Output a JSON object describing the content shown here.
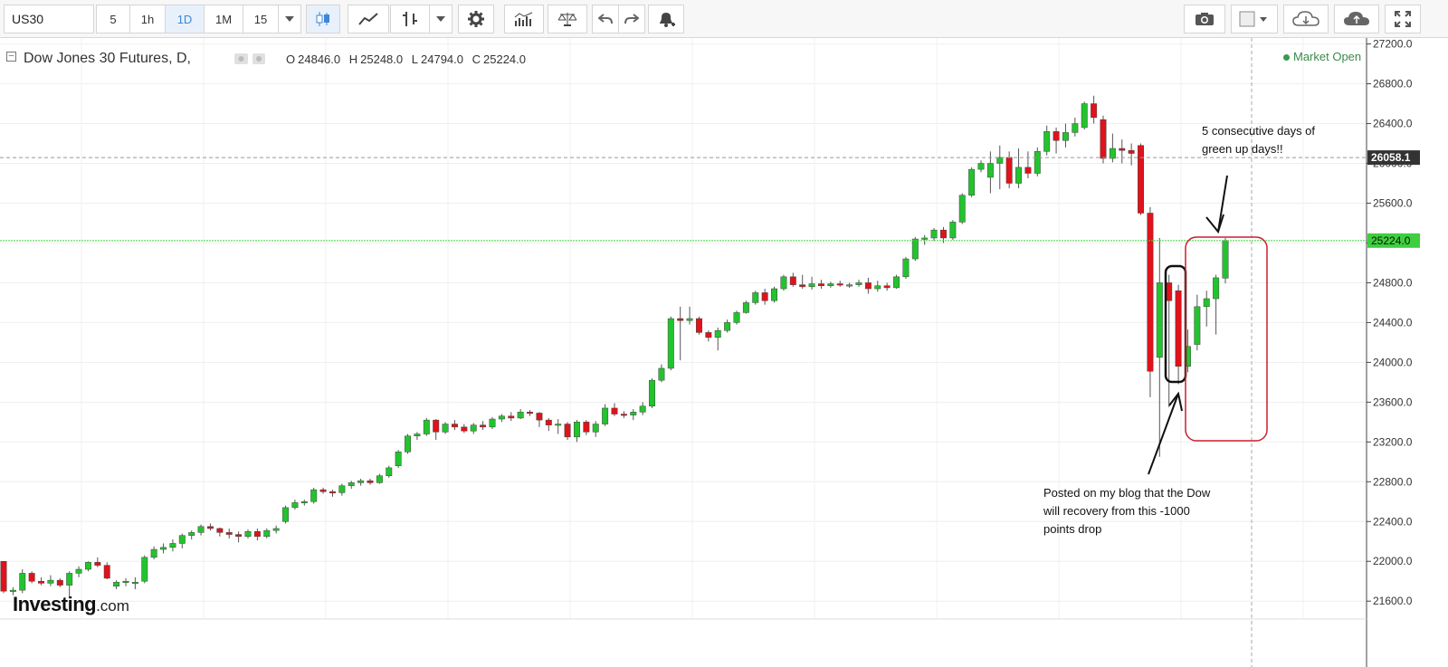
{
  "toolbar": {
    "symbol": "US30",
    "intervals": [
      {
        "label": "5",
        "active": false
      },
      {
        "label": "1h",
        "active": false
      },
      {
        "label": "1D",
        "active": true
      },
      {
        "label": "1M",
        "active": false
      },
      {
        "label": "15",
        "active": false
      }
    ],
    "icons": [
      "chevron-down-icon",
      "candlestick-icon",
      "line-chart-icon",
      "bar-chart-icon",
      "chevron-down-icon",
      "gear-icon",
      "indicators-icon",
      "balance-scale-icon",
      "undo-icon",
      "redo-icon",
      "alert-bell-icon",
      "camera-icon",
      "color-square-icon",
      "cloud-download-icon",
      "cloud-upload-icon",
      "fullscreen-icon"
    ]
  },
  "header": {
    "title": "Dow Jones 30 Futures, D,",
    "ohlc": {
      "O": "24846.0",
      "H": "25248.0",
      "L": "24794.0",
      "C": "25224.0"
    },
    "market_status": "Market Open",
    "logo_main": "Investing",
    "logo_suffix": ".com"
  },
  "annotations": {
    "top_note": "5 consecutive days of green up days!!",
    "bottom_note": "Posted on my blog that the Dow will recovery from this -1000 points drop"
  },
  "colors": {
    "up": "#22c42e",
    "down": "#e0121b",
    "price_line": "#3ecf3e",
    "red_box": "#cc1f2b"
  },
  "chart_data": {
    "type": "candlestick",
    "y_ticks": [
      21600,
      22000,
      22400,
      22800,
      23200,
      23600,
      24000,
      24400,
      24800,
      25200,
      25600,
      26000,
      26400,
      26800,
      27200
    ],
    "ylim": [
      21420,
      27260
    ],
    "current_price": "25224.0",
    "crosshair_price": "26058.1",
    "candles": [
      {
        "o": 22000,
        "h": 22000,
        "l": 21680,
        "c": 21700
      },
      {
        "o": 21700,
        "h": 21740,
        "l": 21660,
        "c": 21710
      },
      {
        "o": 21710,
        "h": 21920,
        "l": 21680,
        "c": 21880
      },
      {
        "o": 21880,
        "h": 21900,
        "l": 21780,
        "c": 21800
      },
      {
        "o": 21800,
        "h": 21840,
        "l": 21760,
        "c": 21780
      },
      {
        "o": 21780,
        "h": 21860,
        "l": 21750,
        "c": 21810
      },
      {
        "o": 21810,
        "h": 21830,
        "l": 21740,
        "c": 21760
      },
      {
        "o": 21760,
        "h": 21900,
        "l": 21640,
        "c": 21880
      },
      {
        "o": 21880,
        "h": 21950,
        "l": 21840,
        "c": 21920
      },
      {
        "o": 21920,
        "h": 22000,
        "l": 21900,
        "c": 21990
      },
      {
        "o": 21990,
        "h": 22040,
        "l": 21940,
        "c": 21960
      },
      {
        "o": 21960,
        "h": 21990,
        "l": 21820,
        "c": 21830
      },
      {
        "o": 21750,
        "h": 21810,
        "l": 21720,
        "c": 21790
      },
      {
        "o": 21790,
        "h": 21830,
        "l": 21750,
        "c": 21800
      },
      {
        "o": 21780,
        "h": 21840,
        "l": 21720,
        "c": 21790
      },
      {
        "o": 21800,
        "h": 22060,
        "l": 21780,
        "c": 22040
      },
      {
        "o": 22040,
        "h": 22150,
        "l": 22020,
        "c": 22120
      },
      {
        "o": 22120,
        "h": 22180,
        "l": 22080,
        "c": 22140
      },
      {
        "o": 22140,
        "h": 22220,
        "l": 22100,
        "c": 22180
      },
      {
        "o": 22180,
        "h": 22280,
        "l": 22130,
        "c": 22260
      },
      {
        "o": 22260,
        "h": 22310,
        "l": 22220,
        "c": 22290
      },
      {
        "o": 22290,
        "h": 22370,
        "l": 22260,
        "c": 22350
      },
      {
        "o": 22350,
        "h": 22380,
        "l": 22310,
        "c": 22330
      },
      {
        "o": 22330,
        "h": 22340,
        "l": 22250,
        "c": 22290
      },
      {
        "o": 22290,
        "h": 22330,
        "l": 22230,
        "c": 22270
      },
      {
        "o": 22270,
        "h": 22300,
        "l": 22190,
        "c": 22250
      },
      {
        "o": 22250,
        "h": 22320,
        "l": 22230,
        "c": 22300
      },
      {
        "o": 22300,
        "h": 22330,
        "l": 22210,
        "c": 22250
      },
      {
        "o": 22250,
        "h": 22330,
        "l": 22230,
        "c": 22310
      },
      {
        "o": 22310,
        "h": 22360,
        "l": 22280,
        "c": 22330
      },
      {
        "o": 22400,
        "h": 22560,
        "l": 22380,
        "c": 22540
      },
      {
        "o": 22540,
        "h": 22620,
        "l": 22520,
        "c": 22590
      },
      {
        "o": 22590,
        "h": 22620,
        "l": 22560,
        "c": 22600
      },
      {
        "o": 22600,
        "h": 22740,
        "l": 22580,
        "c": 22720
      },
      {
        "o": 22720,
        "h": 22740,
        "l": 22680,
        "c": 22700
      },
      {
        "o": 22700,
        "h": 22720,
        "l": 22650,
        "c": 22690
      },
      {
        "o": 22690,
        "h": 22780,
        "l": 22660,
        "c": 22760
      },
      {
        "o": 22760,
        "h": 22810,
        "l": 22730,
        "c": 22790
      },
      {
        "o": 22790,
        "h": 22830,
        "l": 22760,
        "c": 22810
      },
      {
        "o": 22810,
        "h": 22830,
        "l": 22770,
        "c": 22790
      },
      {
        "o": 22790,
        "h": 22880,
        "l": 22780,
        "c": 22860
      },
      {
        "o": 22860,
        "h": 22960,
        "l": 22840,
        "c": 22940
      },
      {
        "o": 22960,
        "h": 23120,
        "l": 22940,
        "c": 23100
      },
      {
        "o": 23100,
        "h": 23280,
        "l": 23080,
        "c": 23260
      },
      {
        "o": 23260,
        "h": 23300,
        "l": 23220,
        "c": 23280
      },
      {
        "o": 23280,
        "h": 23440,
        "l": 23260,
        "c": 23420
      },
      {
        "o": 23420,
        "h": 23430,
        "l": 23220,
        "c": 23300
      },
      {
        "o": 23300,
        "h": 23400,
        "l": 23280,
        "c": 23380
      },
      {
        "o": 23380,
        "h": 23420,
        "l": 23320,
        "c": 23350
      },
      {
        "o": 23350,
        "h": 23380,
        "l": 23290,
        "c": 23310
      },
      {
        "o": 23310,
        "h": 23390,
        "l": 23280,
        "c": 23370
      },
      {
        "o": 23370,
        "h": 23410,
        "l": 23320,
        "c": 23350
      },
      {
        "o": 23350,
        "h": 23450,
        "l": 23330,
        "c": 23430
      },
      {
        "o": 23430,
        "h": 23480,
        "l": 23400,
        "c": 23460
      },
      {
        "o": 23460,
        "h": 23500,
        "l": 23410,
        "c": 23440
      },
      {
        "o": 23440,
        "h": 23530,
        "l": 23430,
        "c": 23500
      },
      {
        "o": 23500,
        "h": 23520,
        "l": 23460,
        "c": 23490
      },
      {
        "o": 23490,
        "h": 23500,
        "l": 23350,
        "c": 23420
      },
      {
        "o": 23420,
        "h": 23440,
        "l": 23310,
        "c": 23370
      },
      {
        "o": 23370,
        "h": 23430,
        "l": 23280,
        "c": 23380
      },
      {
        "o": 23380,
        "h": 23400,
        "l": 23220,
        "c": 23250
      },
      {
        "o": 23250,
        "h": 23420,
        "l": 23200,
        "c": 23400
      },
      {
        "o": 23400,
        "h": 23420,
        "l": 23270,
        "c": 23300
      },
      {
        "o": 23300,
        "h": 23410,
        "l": 23250,
        "c": 23380
      },
      {
        "o": 23380,
        "h": 23580,
        "l": 23360,
        "c": 23540
      },
      {
        "o": 23540,
        "h": 23590,
        "l": 23460,
        "c": 23480
      },
      {
        "o": 23480,
        "h": 23510,
        "l": 23440,
        "c": 23470
      },
      {
        "o": 23470,
        "h": 23530,
        "l": 23420,
        "c": 23500
      },
      {
        "o": 23500,
        "h": 23600,
        "l": 23470,
        "c": 23560
      },
      {
        "o": 23560,
        "h": 23840,
        "l": 23540,
        "c": 23820
      },
      {
        "o": 23820,
        "h": 23980,
        "l": 23800,
        "c": 23940
      },
      {
        "o": 23940,
        "h": 24460,
        "l": 23920,
        "c": 24440
      },
      {
        "o": 24440,
        "h": 24560,
        "l": 24020,
        "c": 24420
      },
      {
        "o": 24420,
        "h": 24560,
        "l": 24380,
        "c": 24440
      },
      {
        "o": 24440,
        "h": 24460,
        "l": 24280,
        "c": 24300
      },
      {
        "o": 24300,
        "h": 24320,
        "l": 24210,
        "c": 24250
      },
      {
        "o": 24250,
        "h": 24350,
        "l": 24120,
        "c": 24320
      },
      {
        "o": 24320,
        "h": 24430,
        "l": 24300,
        "c": 24400
      },
      {
        "o": 24400,
        "h": 24520,
        "l": 24380,
        "c": 24500
      },
      {
        "o": 24500,
        "h": 24620,
        "l": 24490,
        "c": 24600
      },
      {
        "o": 24600,
        "h": 24720,
        "l": 24580,
        "c": 24700
      },
      {
        "o": 24700,
        "h": 24740,
        "l": 24580,
        "c": 24620
      },
      {
        "o": 24620,
        "h": 24760,
        "l": 24600,
        "c": 24740
      },
      {
        "o": 24740,
        "h": 24880,
        "l": 24720,
        "c": 24860
      },
      {
        "o": 24860,
        "h": 24900,
        "l": 24760,
        "c": 24780
      },
      {
        "o": 24780,
        "h": 24880,
        "l": 24740,
        "c": 24760
      },
      {
        "o": 24760,
        "h": 24860,
        "l": 24730,
        "c": 24790
      },
      {
        "o": 24790,
        "h": 24830,
        "l": 24740,
        "c": 24770
      },
      {
        "o": 24770,
        "h": 24810,
        "l": 24750,
        "c": 24790
      },
      {
        "o": 24790,
        "h": 24820,
        "l": 24760,
        "c": 24780
      },
      {
        "o": 24780,
        "h": 24800,
        "l": 24750,
        "c": 24780
      },
      {
        "o": 24780,
        "h": 24830,
        "l": 24760,
        "c": 24800
      },
      {
        "o": 24800,
        "h": 24850,
        "l": 24690,
        "c": 24740
      },
      {
        "o": 24740,
        "h": 24820,
        "l": 24710,
        "c": 24770
      },
      {
        "o": 24770,
        "h": 24800,
        "l": 24720,
        "c": 24750
      },
      {
        "o": 24750,
        "h": 24880,
        "l": 24740,
        "c": 24860
      },
      {
        "o": 24860,
        "h": 25060,
        "l": 24840,
        "c": 25040
      },
      {
        "o": 25040,
        "h": 25260,
        "l": 25020,
        "c": 25240
      },
      {
        "o": 25240,
        "h": 25280,
        "l": 25180,
        "c": 25250
      },
      {
        "o": 25250,
        "h": 25350,
        "l": 25220,
        "c": 25330
      },
      {
        "o": 25330,
        "h": 25360,
        "l": 25200,
        "c": 25250
      },
      {
        "o": 25250,
        "h": 25430,
        "l": 25230,
        "c": 25410
      },
      {
        "o": 25410,
        "h": 25700,
        "l": 25390,
        "c": 25680
      },
      {
        "o": 25680,
        "h": 25960,
        "l": 25660,
        "c": 25940
      },
      {
        "o": 25940,
        "h": 26030,
        "l": 25910,
        "c": 26000
      },
      {
        "o": 25860,
        "h": 26120,
        "l": 25700,
        "c": 26000
      },
      {
        "o": 26000,
        "h": 26180,
        "l": 25740,
        "c": 26060
      },
      {
        "o": 26060,
        "h": 26120,
        "l": 25750,
        "c": 25800
      },
      {
        "o": 25800,
        "h": 26150,
        "l": 25750,
        "c": 25960
      },
      {
        "o": 25960,
        "h": 26120,
        "l": 25850,
        "c": 25900
      },
      {
        "o": 25900,
        "h": 26160,
        "l": 25870,
        "c": 26120
      },
      {
        "o": 26120,
        "h": 26380,
        "l": 26080,
        "c": 26320
      },
      {
        "o": 26320,
        "h": 26360,
        "l": 26100,
        "c": 26230
      },
      {
        "o": 26230,
        "h": 26400,
        "l": 26160,
        "c": 26310
      },
      {
        "o": 26310,
        "h": 26460,
        "l": 26270,
        "c": 26400
      },
      {
        "o": 26360,
        "h": 26620,
        "l": 26340,
        "c": 26600
      },
      {
        "o": 26600,
        "h": 26680,
        "l": 26400,
        "c": 26460
      },
      {
        "o": 26440,
        "h": 26480,
        "l": 26000,
        "c": 26050
      },
      {
        "o": 26050,
        "h": 26300,
        "l": 26010,
        "c": 26150
      },
      {
        "o": 26150,
        "h": 26240,
        "l": 26000,
        "c": 26130
      },
      {
        "o": 26130,
        "h": 26200,
        "l": 25980,
        "c": 26100
      },
      {
        "o": 26180,
        "h": 26200,
        "l": 25480,
        "c": 25500
      },
      {
        "o": 25500,
        "h": 25560,
        "l": 23650,
        "c": 23910
      },
      {
        "o": 24050,
        "h": 25250,
        "l": 23050,
        "c": 24800
      },
      {
        "o": 24800,
        "h": 24880,
        "l": 23550,
        "c": 24620
      },
      {
        "o": 24720,
        "h": 24780,
        "l": 23780,
        "c": 23960
      },
      {
        "o": 23960,
        "h": 24330,
        "l": 23900,
        "c": 24160
      },
      {
        "o": 24180,
        "h": 24680,
        "l": 24120,
        "c": 24560
      },
      {
        "o": 24560,
        "h": 24720,
        "l": 24360,
        "c": 24640
      },
      {
        "o": 24640,
        "h": 24880,
        "l": 24280,
        "c": 24850
      },
      {
        "o": 24846,
        "h": 25248,
        "l": 24794,
        "c": 25224
      }
    ]
  }
}
